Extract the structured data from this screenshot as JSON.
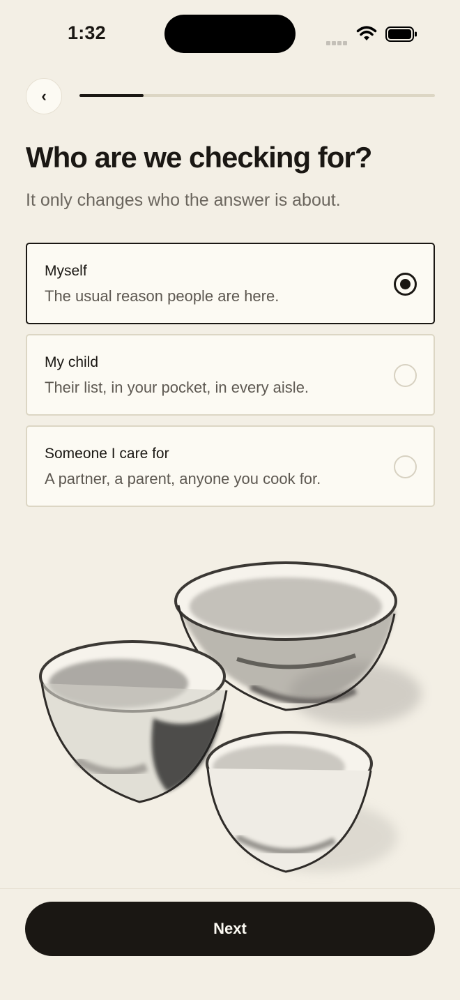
{
  "status_bar": {
    "time": "1:32"
  },
  "header": {
    "back_label": "‹",
    "progress_fraction": 0.18
  },
  "title": "Who are we checking for?",
  "subtitle": "It only changes who the answer is about.",
  "options": [
    {
      "title": "Myself",
      "description": "The usual reason people are here.",
      "selected": true
    },
    {
      "title": "My child",
      "description": "Their list, in your pocket, in every aisle.",
      "selected": false
    },
    {
      "title": "Someone I care for",
      "description": "A partner, a parent, anyone you cook for.",
      "selected": false
    }
  ],
  "illustration": "ink-wash-bowls",
  "footer": {
    "next_label": "Next"
  },
  "colors": {
    "background": "#f3efe5",
    "card": "#fcfaf3",
    "ink": "#1a1713",
    "muted": "#6b665e",
    "border": "#dcd6c4"
  }
}
